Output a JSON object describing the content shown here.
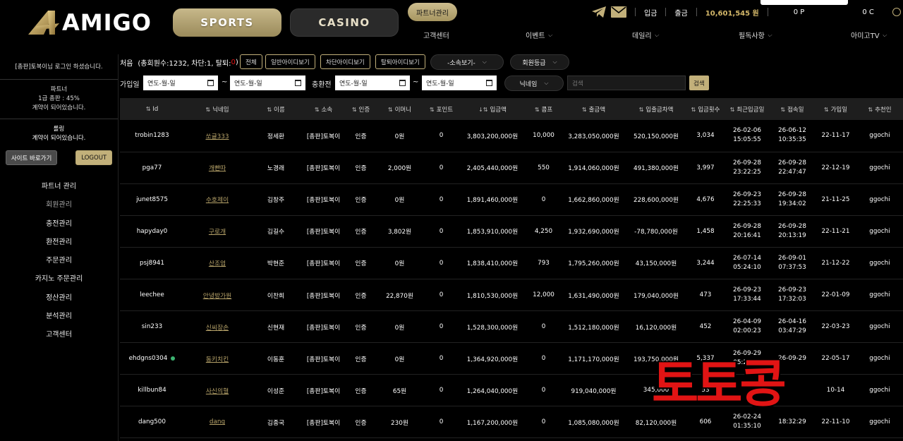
{
  "header": {
    "logo_text": "AMIGO",
    "sports_label": "SPORTS",
    "casino_label": "CASINO",
    "partner_label": "파트너관리",
    "nav": [
      "고객센터",
      "이벤트",
      "데일리",
      "필독사항",
      "아미고TV"
    ],
    "deposit_label": "입금",
    "withdraw_label": "출금",
    "balance": "10,601,545 원",
    "point": "0 P",
    "coin": "0 C"
  },
  "sidebar": {
    "login_msg": "[총판]토복이님 로그인 하셨습니다.",
    "partner_title": "파트너",
    "partner_rate": "1급 총판 : 45%",
    "partner_contract": "계약이 되어있습니다.",
    "rolling_title": "롤링",
    "rolling_contract": "계약이 되어있습니다.",
    "site_button": "사이트 바로가기",
    "logout_button": "LOGOUT",
    "menu": [
      "파트너 관리",
      "회원관리",
      "충전관리",
      "환전관리",
      "주문관리",
      "카지노 주문관리",
      "정산관리",
      "분석관리",
      "고객센터"
    ]
  },
  "filters": {
    "summary_prefix": "처음",
    "summary_mid": "(총회원수:1232, 차단:1, 탈퇴:",
    "summary_zero": "0",
    "summary_end": ")",
    "btn_all": "전체",
    "btn_normal": "일반아이디보기",
    "btn_blocked": "차단아이디보기",
    "btn_withdrawn": "탈퇴아이디보기",
    "select_affiliation": "-소속보기-",
    "select_grade": "회원등급",
    "join_date_label": "가입일",
    "date_placeholder": "연도-월-일",
    "tilde": "~",
    "exchange_label": "충환전",
    "select_nickname": "닉네임",
    "search_placeholder": "검색",
    "search_button": "검색"
  },
  "table": {
    "sort_icon": "⇅",
    "sort_desc_icon": "↓⇅",
    "columns": [
      "Id",
      "닉네임",
      "이름",
      "소속",
      "인증",
      "이머니",
      "포인트",
      "입금액",
      "콤프",
      "출금액",
      "입출금차액",
      "입금횟수",
      "최근입금일",
      "접속일",
      "가입일",
      "추천인"
    ],
    "rows": [
      {
        "id": "trobin1283",
        "nick": "쏘글333",
        "name": "정세환",
        "aff": "[총판]토복이",
        "auth": "인증",
        "money": "0원",
        "point": "0",
        "deposit": "3,803,200,000원",
        "comp": "10,000",
        "withdraw": "3,283,050,000원",
        "diff": "520,150,000원",
        "count": "3,034",
        "recent_d": "26-02-06",
        "recent_t": "15:05:55",
        "access_d": "26-06-12",
        "access_t": "10:35:35",
        "join": "22-11-17",
        "ref": "ggochi"
      },
      {
        "id": "pga77",
        "nick": "개빤따",
        "name": "노경래",
        "aff": "[총판]토복이",
        "auth": "인증",
        "money": "2,000원",
        "point": "0",
        "deposit": "2,405,440,000원",
        "comp": "550",
        "withdraw": "1,914,060,000원",
        "diff": "491,380,000원",
        "count": "3,997",
        "recent_d": "26-09-28",
        "recent_t": "23:22:25",
        "access_d": "26-09-28",
        "access_t": "22:47:47",
        "join": "22-12-19",
        "ref": "ggochi"
      },
      {
        "id": "junet8575",
        "nick": "수호제이",
        "name": "김창주",
        "aff": "[총판]토복이",
        "auth": "인증",
        "money": "0원",
        "point": "0",
        "deposit": "1,891,460,000원",
        "comp": "0",
        "withdraw": "1,662,860,000원",
        "diff": "228,600,000원",
        "count": "4,676",
        "recent_d": "26-09-23",
        "recent_t": "22:25:33",
        "access_d": "26-09-28",
        "access_t": "19:34:02",
        "join": "21-11-25",
        "ref": "ggochi"
      },
      {
        "id": "hapyday0",
        "nick": "구로개",
        "name": "김길수",
        "aff": "[총판]토복이",
        "auth": "인증",
        "money": "3,802원",
        "point": "0",
        "deposit": "1,853,910,000원",
        "comp": "4,250",
        "withdraw": "1,932,690,000원",
        "diff": "-78,780,000원",
        "count": "1,458",
        "recent_d": "26-09-28",
        "recent_t": "20:16:41",
        "access_d": "26-09-28",
        "access_t": "20:13:19",
        "join": "22-11-21",
        "ref": "ggochi"
      },
      {
        "id": "psj8941",
        "nick": "산조엄",
        "name": "박현준",
        "aff": "[총판]토복이",
        "auth": "인증",
        "money": "0원",
        "point": "0",
        "deposit": "1,838,410,000원",
        "comp": "793",
        "withdraw": "1,795,260,000원",
        "diff": "43,150,000원",
        "count": "3,244",
        "recent_d": "26-07-14",
        "recent_t": "05:24:10",
        "access_d": "26-09-01",
        "access_t": "07:37:53",
        "join": "21-12-22",
        "ref": "ggochi"
      },
      {
        "id": "leechee",
        "nick": "안녕방가원",
        "name": "이찬희",
        "aff": "[총판]토복이",
        "auth": "인증",
        "money": "22,870원",
        "point": "0",
        "deposit": "1,810,530,000원",
        "comp": "12,000",
        "withdraw": "1,631,490,000원",
        "diff": "179,040,000원",
        "count": "473",
        "recent_d": "26-09-23",
        "recent_t": "17:33:44",
        "access_d": "26-09-23",
        "access_t": "17:32:03",
        "join": "22-01-09",
        "ref": "ggochi"
      },
      {
        "id": "sin233",
        "nick": "신씨장손",
        "name": "신현재",
        "aff": "[총판]토복이",
        "auth": "인증",
        "money": "0원",
        "point": "0",
        "deposit": "1,528,300,000원",
        "comp": "0",
        "withdraw": "1,512,180,000원",
        "diff": "16,120,000원",
        "count": "452",
        "recent_d": "26-04-09",
        "recent_t": "02:00:23",
        "access_d": "26-04-16",
        "access_t": "03:47:29",
        "join": "22-03-23",
        "ref": "ggochi"
      },
      {
        "id": "ehdgns0304",
        "nick": "동키치킨",
        "name": "이동훈",
        "aff": "[총판]토복이",
        "auth": "인증",
        "money": "0원",
        "point": "0",
        "deposit": "1,364,920,000원",
        "comp": "0",
        "withdraw": "1,171,170,000원",
        "diff": "193,750,000원",
        "count": "5,337",
        "recent_d": "26-09-29",
        "recent_t": "05:21:55",
        "access_d": "26-09-29",
        "access_t": "",
        "join": "22-05-17",
        "ref": "ggochi",
        "online": true
      },
      {
        "id": "killbun84",
        "nick": "사신의혈",
        "name": "이성준",
        "aff": "[총판]토복이",
        "auth": "인증",
        "money": "65원",
        "point": "0",
        "deposit": "1,264,040,000원",
        "comp": "0",
        "withdraw": "919,040,000원",
        "diff": "345,000",
        "count": "53",
        "recent_d": "",
        "recent_t": "",
        "access_d": "",
        "access_t": "",
        "join": "10-14",
        "ref": "ggochi"
      },
      {
        "id": "dang500",
        "nick": "dang",
        "name": "김종국",
        "aff": "[총판]토복이",
        "auth": "인증",
        "money": "230원",
        "point": "0",
        "deposit": "1,167,200,000원",
        "comp": "0",
        "withdraw": "1,085,080,000원",
        "diff": "82,120,000원",
        "count": "606",
        "recent_d": "26-02-24",
        "recent_t": "01:35:10",
        "access_d": "",
        "access_t": "18:32:29",
        "join": "22-11-10",
        "ref": "ggochi"
      }
    ]
  },
  "watermark": "토토콩",
  "colors": {
    "gold": "#c2b07a",
    "red": "#e11414",
    "online": "#3cb371"
  }
}
